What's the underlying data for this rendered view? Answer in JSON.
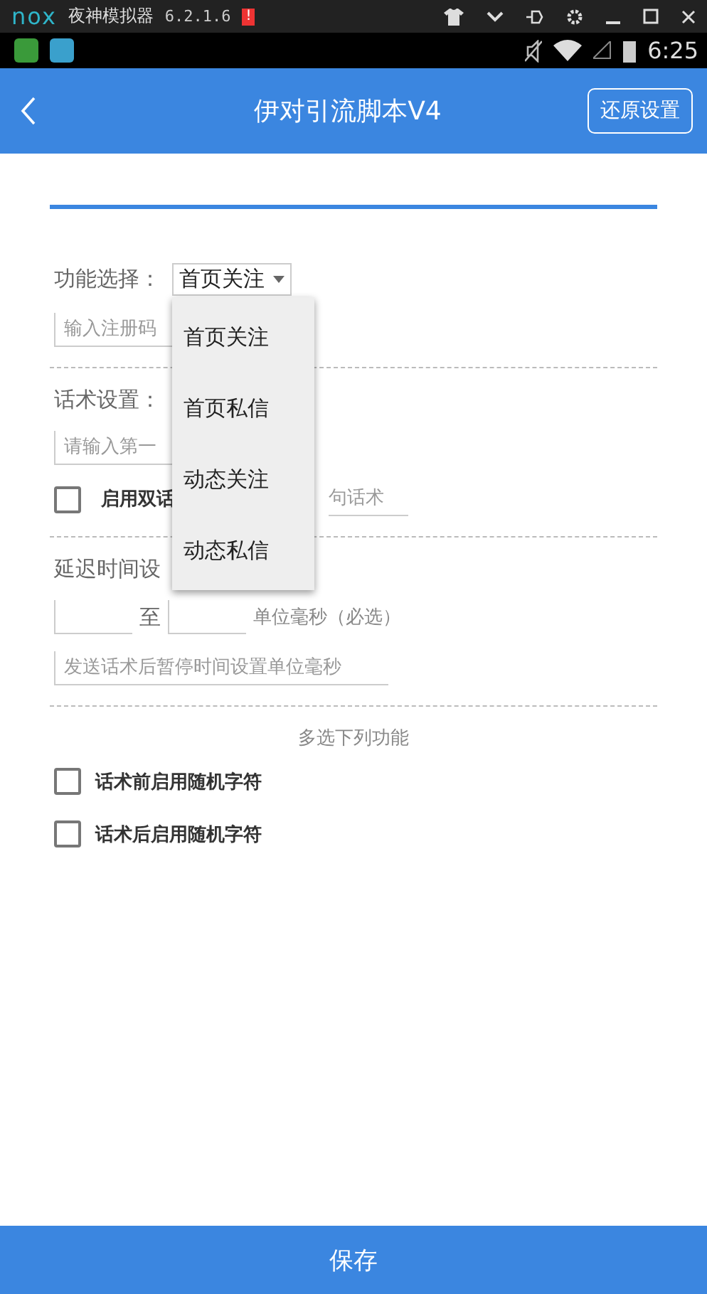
{
  "emulator": {
    "logo": "nox",
    "title": "夜神模拟器",
    "version": "6.2.1.6",
    "alert": "!"
  },
  "status_bar": {
    "time": "6:25"
  },
  "app_bar": {
    "title": "伊对引流脚本V4",
    "action": "还原设置"
  },
  "function_select": {
    "label": "功能选择：",
    "value": "首页关注",
    "expanded": true,
    "options": [
      {
        "label": "首页关注"
      },
      {
        "label": "首页私信"
      },
      {
        "label": "动态关注"
      },
      {
        "label": "动态私信"
      }
    ]
  },
  "register_code": {
    "placeholder": "输入注册码"
  },
  "script": {
    "label": "话术设置：",
    "first_placeholder": "请输入第一",
    "dual": {
      "label": "启用双话",
      "checked": false
    },
    "second_placeholder": "句话术"
  },
  "delay": {
    "label": "延迟时间设",
    "separator": "至",
    "unit": "单位毫秒（必选）",
    "pause_placeholder": "发送话术后暂停时间设置单位毫秒"
  },
  "multi": {
    "heading": "多选下列功能",
    "options": [
      {
        "label": "话术前启用随机字符",
        "checked": false
      },
      {
        "label": "话术后启用随机字符",
        "checked": false
      }
    ]
  },
  "save": "保存"
}
